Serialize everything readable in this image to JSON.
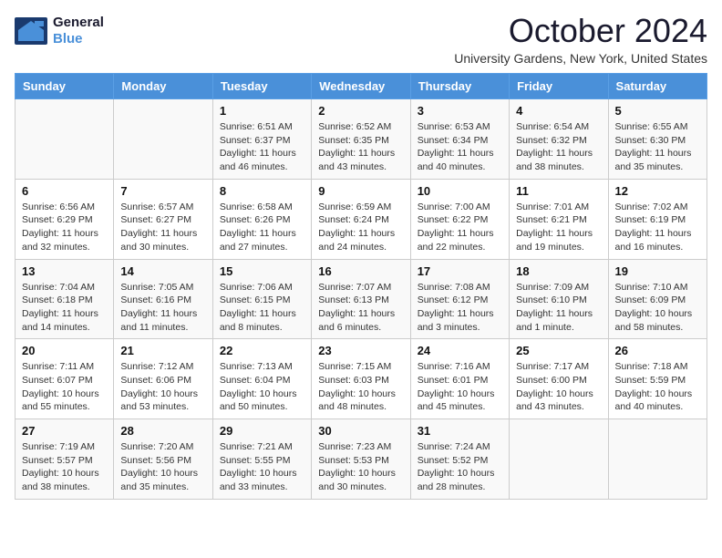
{
  "header": {
    "logo_line1": "General",
    "logo_line2": "Blue",
    "month_title": "October 2024",
    "subtitle": "University Gardens, New York, United States"
  },
  "weekdays": [
    "Sunday",
    "Monday",
    "Tuesday",
    "Wednesday",
    "Thursday",
    "Friday",
    "Saturday"
  ],
  "weeks": [
    [
      null,
      null,
      {
        "day": 1,
        "sunrise": "6:51 AM",
        "sunset": "6:37 PM",
        "daylight": "11 hours and 46 minutes."
      },
      {
        "day": 2,
        "sunrise": "6:52 AM",
        "sunset": "6:35 PM",
        "daylight": "11 hours and 43 minutes."
      },
      {
        "day": 3,
        "sunrise": "6:53 AM",
        "sunset": "6:34 PM",
        "daylight": "11 hours and 40 minutes."
      },
      {
        "day": 4,
        "sunrise": "6:54 AM",
        "sunset": "6:32 PM",
        "daylight": "11 hours and 38 minutes."
      },
      {
        "day": 5,
        "sunrise": "6:55 AM",
        "sunset": "6:30 PM",
        "daylight": "11 hours and 35 minutes."
      }
    ],
    [
      {
        "day": 6,
        "sunrise": "6:56 AM",
        "sunset": "6:29 PM",
        "daylight": "11 hours and 32 minutes."
      },
      {
        "day": 7,
        "sunrise": "6:57 AM",
        "sunset": "6:27 PM",
        "daylight": "11 hours and 30 minutes."
      },
      {
        "day": 8,
        "sunrise": "6:58 AM",
        "sunset": "6:26 PM",
        "daylight": "11 hours and 27 minutes."
      },
      {
        "day": 9,
        "sunrise": "6:59 AM",
        "sunset": "6:24 PM",
        "daylight": "11 hours and 24 minutes."
      },
      {
        "day": 10,
        "sunrise": "7:00 AM",
        "sunset": "6:22 PM",
        "daylight": "11 hours and 22 minutes."
      },
      {
        "day": 11,
        "sunrise": "7:01 AM",
        "sunset": "6:21 PM",
        "daylight": "11 hours and 19 minutes."
      },
      {
        "day": 12,
        "sunrise": "7:02 AM",
        "sunset": "6:19 PM",
        "daylight": "11 hours and 16 minutes."
      }
    ],
    [
      {
        "day": 13,
        "sunrise": "7:04 AM",
        "sunset": "6:18 PM",
        "daylight": "11 hours and 14 minutes."
      },
      {
        "day": 14,
        "sunrise": "7:05 AM",
        "sunset": "6:16 PM",
        "daylight": "11 hours and 11 minutes."
      },
      {
        "day": 15,
        "sunrise": "7:06 AM",
        "sunset": "6:15 PM",
        "daylight": "11 hours and 8 minutes."
      },
      {
        "day": 16,
        "sunrise": "7:07 AM",
        "sunset": "6:13 PM",
        "daylight": "11 hours and 6 minutes."
      },
      {
        "day": 17,
        "sunrise": "7:08 AM",
        "sunset": "6:12 PM",
        "daylight": "11 hours and 3 minutes."
      },
      {
        "day": 18,
        "sunrise": "7:09 AM",
        "sunset": "6:10 PM",
        "daylight": "11 hours and 1 minute."
      },
      {
        "day": 19,
        "sunrise": "7:10 AM",
        "sunset": "6:09 PM",
        "daylight": "10 hours and 58 minutes."
      }
    ],
    [
      {
        "day": 20,
        "sunrise": "7:11 AM",
        "sunset": "6:07 PM",
        "daylight": "10 hours and 55 minutes."
      },
      {
        "day": 21,
        "sunrise": "7:12 AM",
        "sunset": "6:06 PM",
        "daylight": "10 hours and 53 minutes."
      },
      {
        "day": 22,
        "sunrise": "7:13 AM",
        "sunset": "6:04 PM",
        "daylight": "10 hours and 50 minutes."
      },
      {
        "day": 23,
        "sunrise": "7:15 AM",
        "sunset": "6:03 PM",
        "daylight": "10 hours and 48 minutes."
      },
      {
        "day": 24,
        "sunrise": "7:16 AM",
        "sunset": "6:01 PM",
        "daylight": "10 hours and 45 minutes."
      },
      {
        "day": 25,
        "sunrise": "7:17 AM",
        "sunset": "6:00 PM",
        "daylight": "10 hours and 43 minutes."
      },
      {
        "day": 26,
        "sunrise": "7:18 AM",
        "sunset": "5:59 PM",
        "daylight": "10 hours and 40 minutes."
      }
    ],
    [
      {
        "day": 27,
        "sunrise": "7:19 AM",
        "sunset": "5:57 PM",
        "daylight": "10 hours and 38 minutes."
      },
      {
        "day": 28,
        "sunrise": "7:20 AM",
        "sunset": "5:56 PM",
        "daylight": "10 hours and 35 minutes."
      },
      {
        "day": 29,
        "sunrise": "7:21 AM",
        "sunset": "5:55 PM",
        "daylight": "10 hours and 33 minutes."
      },
      {
        "day": 30,
        "sunrise": "7:23 AM",
        "sunset": "5:53 PM",
        "daylight": "10 hours and 30 minutes."
      },
      {
        "day": 31,
        "sunrise": "7:24 AM",
        "sunset": "5:52 PM",
        "daylight": "10 hours and 28 minutes."
      },
      null,
      null
    ]
  ]
}
